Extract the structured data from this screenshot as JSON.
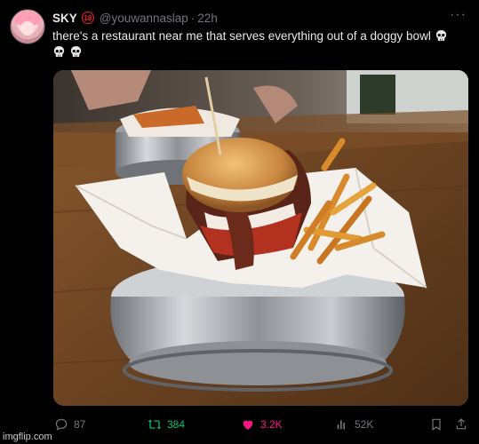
{
  "tweet": {
    "name": "SKY",
    "badge": "18",
    "handle": "@youwannaslap",
    "separator": "·",
    "time": "22h",
    "more_label": "···",
    "text": "there's a restaurant near me that serves everything out of a doggy bowl"
  },
  "media": {
    "alt": "Burger with bacon and french fries served in a stainless steel dog bowl on a wooden table"
  },
  "actions": {
    "replies": "87",
    "reposts": "384",
    "likes": "3.2K",
    "views": "52K"
  },
  "colors": {
    "background": "#000000",
    "text": "#e7e9ea",
    "muted": "#71767b",
    "repost": "#00ba7c",
    "like": "#f91880",
    "badge": "#f4212e"
  },
  "icons": [
    "reply-icon",
    "repost-icon",
    "like-icon",
    "views-icon",
    "bookmark-icon",
    "share-icon",
    "skull-icon"
  ],
  "watermark": "imgflip.com"
}
